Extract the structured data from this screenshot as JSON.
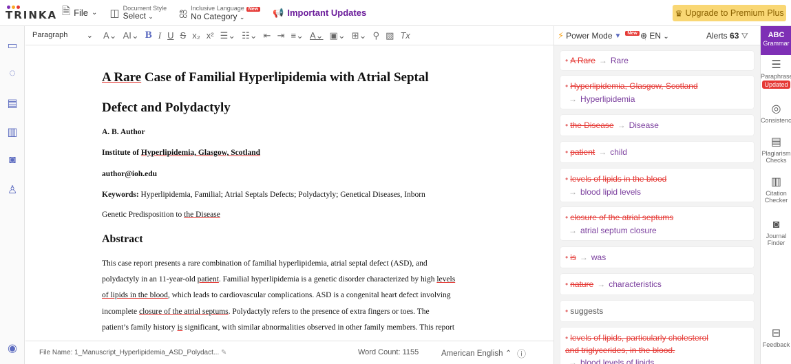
{
  "topbar": {
    "logo": "TRINKA",
    "logo_colors": [
      "#7e2fb5",
      "#f9a825",
      "#e53935"
    ],
    "file_label": "File",
    "doc_style_small": "Document Style",
    "doc_style_value": "Select",
    "incl_small": "Inclusive Language",
    "incl_badge": "New",
    "incl_value": "No Category",
    "important_updates": "Important Updates",
    "upgrade": "Upgrade to Premium Plus"
  },
  "editor_toolbar": {
    "paragraph": "Paragraph"
  },
  "document": {
    "title_line1": "A Rare Case of Familial Hyperlipidemia with Atrial Septal",
    "title_line2": "Defect and Polydactyly",
    "author": "A. B. Author",
    "institute_prefix": "Institute of ",
    "institute_ul": "Hyperlipidemia, Glasgow, Scotland",
    "email": "author@ioh.edu",
    "keywords_label": "Keywords:",
    "keywords_text": " Hyperlipidemia, Familial; Atrial Septals Defects; Polydactyly; Genetical Diseases, Inborn",
    "keywords_line2_prefix": "Genetic Predisposition to ",
    "keywords_line2_ul": "the Disease",
    "abstract_heading": "Abstract",
    "abs1": "This case report presents a rare combination of familial hyperlipidemia, atrial septal defect (ASD), and",
    "abs2_a": "polydactyly in an 11-year-old ",
    "abs2_ul1": "patient",
    "abs2_b": ". Familial hyperlipidemia is a genetic disorder characterized by high ",
    "abs2_ul2": "levels",
    "abs3_ul": "of lipids in the blood",
    "abs3_b": ", which leads to cardiovascular complications. ASD is a congenital heart defect involving",
    "abs4_a": "incomplete ",
    "abs4_ul": "closure of the atrial septums",
    "abs4_b": ". Polydactyly refers to the presence of extra fingers or toes. The",
    "abs5_a": "patient’s family history ",
    "abs5_ul": "is",
    "abs5_b": " significant, with similar abnormalities observed in other family members. This report"
  },
  "statusbar": {
    "filename": "File Name: 1_Manuscript_Hyperlipidemia_ASD_Polydact...",
    "word_count": "Word Count: 1155",
    "language": "American English"
  },
  "suggestions": {
    "power_mode": "Power Mode",
    "power_badge": "New",
    "lang": "EN",
    "alerts_label": "Alerts",
    "alerts_count": "63",
    "cards": [
      {
        "del": "A Rare",
        "rep": "Rare"
      },
      {
        "del": "Hyperlipidemia, Glasgow, Scotland",
        "rep": "Hyperlipidemia"
      },
      {
        "del": "the Disease",
        "rep": "Disease"
      },
      {
        "del": "patient",
        "rep": "child"
      },
      {
        "del": "levels of lipids in the blood",
        "rep": "blood lipid levels"
      },
      {
        "del": "closure of the atrial septums",
        "rep": "atrial septum closure"
      },
      {
        "del": "is",
        "rep": "was"
      },
      {
        "del": "nature",
        "rep": "characteristics"
      },
      {
        "text": "suggests"
      },
      {
        "del1": "levels of lipids, particularly cholesterol",
        "del2": "and triglycerides, in the blood.",
        "rep": "blood levels of lipids"
      }
    ]
  },
  "rightbar": {
    "grammar_icon": "ABC",
    "grammar": "Grammar",
    "paraphraser": "Paraphraser",
    "updated": "Updated",
    "consistency": "Consistency",
    "plagiarism1": "Plagiarism",
    "plagiarism2": "Checks",
    "citation1": "Citation",
    "citation2": "Checker",
    "journal1": "Journal",
    "journal2": "Finder",
    "feedback": "Feedback"
  }
}
